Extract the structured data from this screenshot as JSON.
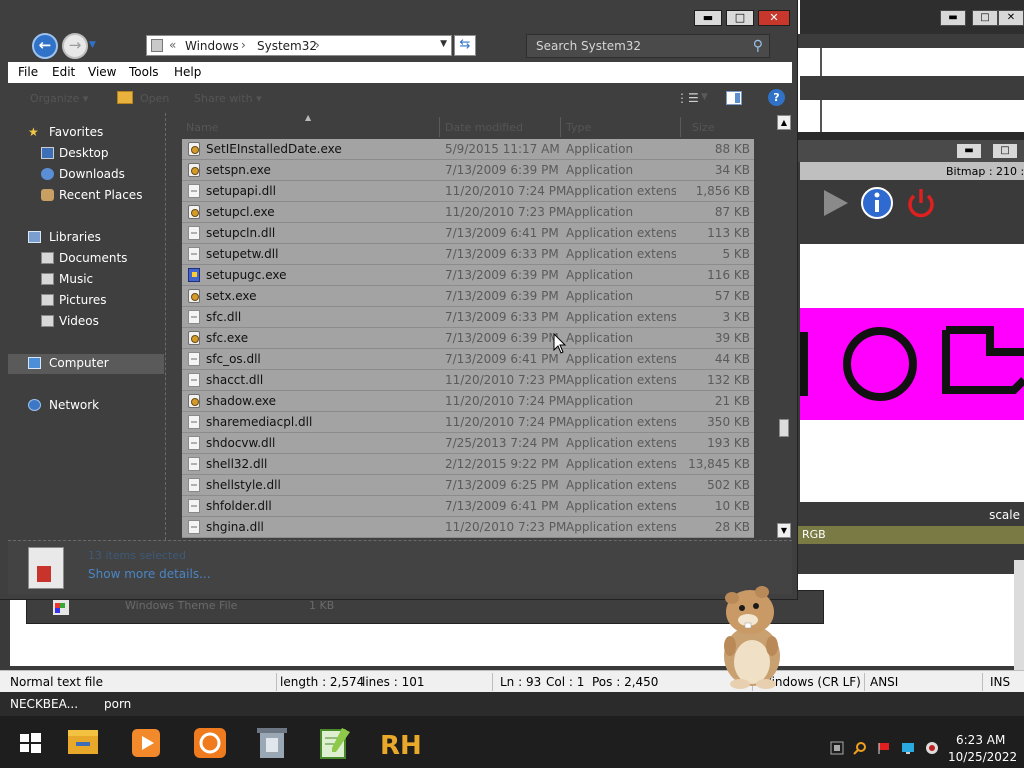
{
  "background": {
    "viewer": {
      "bitmap_info": "Bitmap : 210 :",
      "scale_label": "scale",
      "rgb_label": "RGB"
    },
    "notepad": {
      "strip_text": "Windows Theme File",
      "strip_size": "1 KB",
      "status": {
        "file_type": "Normal text file",
        "length": "length : 2,574",
        "lines": "lines : 101",
        "ln": "Ln : 93",
        "col": "Col : 1",
        "pos": "Pos : 2,450",
        "eol": "Windows (CR LF)",
        "encoding": "ANSI",
        "mode": "INS"
      }
    }
  },
  "explorer": {
    "title_buttons": {
      "minimize": "▬",
      "maximize": "□",
      "close": "✕"
    },
    "address": {
      "segments": [
        "Windows",
        "System32"
      ]
    },
    "search": {
      "placeholder": "Search System32"
    },
    "menu": [
      "File",
      "Edit",
      "View",
      "Tools",
      "Help"
    ],
    "commands": [
      "Organize ▾",
      "Open",
      "Share with ▾"
    ],
    "nav": {
      "favorites": {
        "label": "Favorites",
        "items": [
          "Desktop",
          "Downloads",
          "Recent Places"
        ]
      },
      "libraries": {
        "label": "Libraries",
        "items": [
          "Documents",
          "Music",
          "Pictures",
          "Videos"
        ]
      },
      "computer": "Computer",
      "network": "Network"
    },
    "columns": [
      "Name",
      "Date modified",
      "Type",
      "Size"
    ],
    "files": [
      {
        "name": "SetIEInstalledDate.exe",
        "date": "5/9/2015 11:17 AM",
        "type": "Application",
        "size": "88 KB",
        "icon": "exe-icon"
      },
      {
        "name": "setspn.exe",
        "date": "7/13/2009 6:39 PM",
        "type": "Application",
        "size": "34 KB",
        "icon": "exe-icon"
      },
      {
        "name": "setupapi.dll",
        "date": "11/20/2010 7:24 PM",
        "type": "Application extens...",
        "size": "1,856 KB",
        "icon": "dll-icon"
      },
      {
        "name": "setupcl.exe",
        "date": "11/20/2010 7:23 PM",
        "type": "Application",
        "size": "87 KB",
        "icon": "exe-icon"
      },
      {
        "name": "setupcln.dll",
        "date": "7/13/2009 6:41 PM",
        "type": "Application extens...",
        "size": "113 KB",
        "icon": "dll-icon"
      },
      {
        "name": "setupetw.dll",
        "date": "7/13/2009 6:33 PM",
        "type": "Application extens...",
        "size": "5 KB",
        "icon": "dll-icon"
      },
      {
        "name": "setupugc.exe",
        "date": "7/13/2009 6:39 PM",
        "type": "Application",
        "size": "116 KB",
        "icon": "setup-icon"
      },
      {
        "name": "setx.exe",
        "date": "7/13/2009 6:39 PM",
        "type": "Application",
        "size": "57 KB",
        "icon": "exe-icon"
      },
      {
        "name": "sfc.dll",
        "date": "7/13/2009 6:33 PM",
        "type": "Application extens...",
        "size": "3 KB",
        "icon": "dll-icon"
      },
      {
        "name": "sfc.exe",
        "date": "7/13/2009 6:39 PM",
        "type": "Application",
        "size": "39 KB",
        "icon": "exe-icon"
      },
      {
        "name": "sfc_os.dll",
        "date": "7/13/2009 6:41 PM",
        "type": "Application extens...",
        "size": "44 KB",
        "icon": "dll-icon"
      },
      {
        "name": "shacct.dll",
        "date": "11/20/2010 7:23 PM",
        "type": "Application extens...",
        "size": "132 KB",
        "icon": "dll-icon"
      },
      {
        "name": "shadow.exe",
        "date": "11/20/2010 7:24 PM",
        "type": "Application",
        "size": "21 KB",
        "icon": "exe-icon"
      },
      {
        "name": "sharemediacpl.dll",
        "date": "11/20/2010 7:24 PM",
        "type": "Application extens...",
        "size": "350 KB",
        "icon": "dll-icon"
      },
      {
        "name": "shdocvw.dll",
        "date": "7/25/2013 7:24 PM",
        "type": "Application extens...",
        "size": "193 KB",
        "icon": "dll-icon"
      },
      {
        "name": "shell32.dll",
        "date": "2/12/2015 9:22 PM",
        "type": "Application extens...",
        "size": "13,845 KB",
        "icon": "dll-icon"
      },
      {
        "name": "shellstyle.dll",
        "date": "7/13/2009 6:25 PM",
        "type": "Application extens...",
        "size": "502 KB",
        "icon": "dll-icon"
      },
      {
        "name": "shfolder.dll",
        "date": "7/13/2009 6:41 PM",
        "type": "Application extens...",
        "size": "10 KB",
        "icon": "dll-icon"
      },
      {
        "name": "shgina.dll",
        "date": "11/20/2010 7:23 PM",
        "type": "Application extens...",
        "size": "28 KB",
        "icon": "dll-icon"
      }
    ],
    "details": {
      "name": "13 items selected",
      "link": "Show more details..."
    }
  },
  "taskbar": {
    "labels": [
      "NECKBEA...",
      "porn"
    ],
    "apps": [
      "start-button",
      "file-explorer-icon",
      "media-player-icon",
      "uc-browser-icon",
      "recycle-tool-icon",
      "notepadpp-icon",
      "rh-icon"
    ],
    "tray": [
      "network-icon",
      "search-tray-icon",
      "flag-icon",
      "display-icon",
      "speaker-icon"
    ],
    "clock": {
      "time": "6:23 AM",
      "date": "10/25/2022"
    }
  },
  "colors": {
    "accent": "#2f72c8",
    "row_bg": "#a3a3a3",
    "magenta": "#ff00ff",
    "close_red": "#c7372b"
  }
}
